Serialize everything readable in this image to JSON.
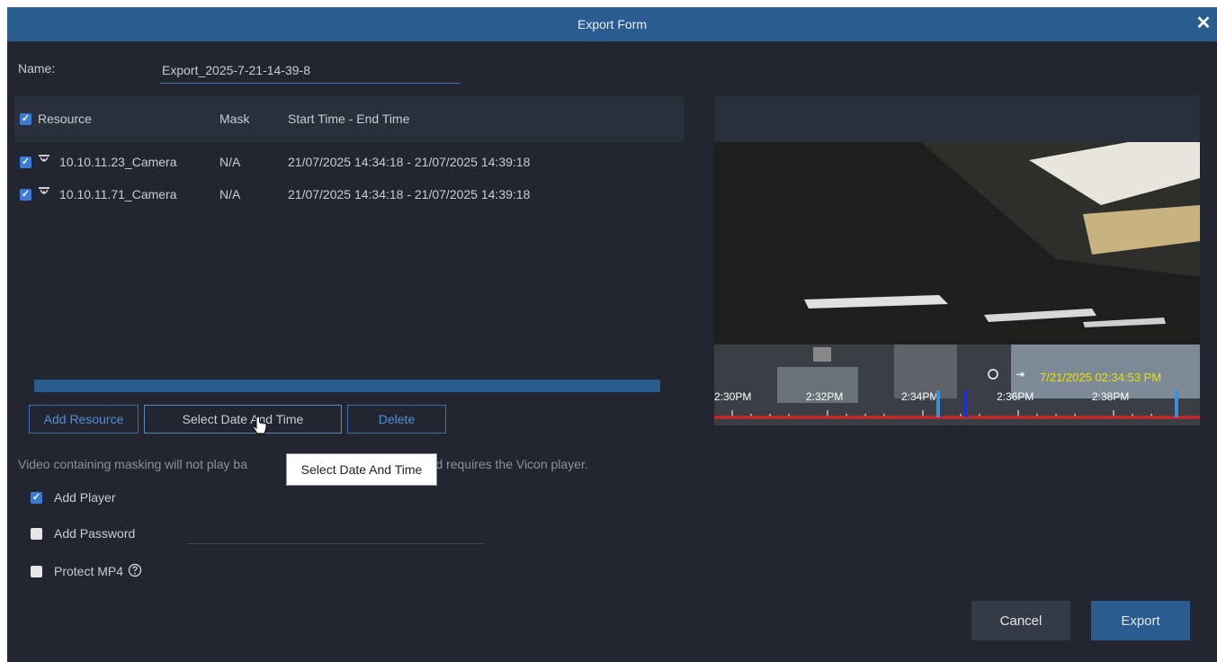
{
  "window": {
    "title": "Export Form"
  },
  "form": {
    "name_label": "Name:",
    "name_value": "Export_2025-7-21-14-39-8"
  },
  "table": {
    "columns": [
      "Resource",
      "Mask",
      "Start Time - End Time"
    ],
    "rows": [
      {
        "resource": "10.10.11.23_Camera",
        "mask": "N/A",
        "time": "21/07/2025 14:34:18 - 21/07/2025 14:39:18"
      },
      {
        "resource": "10.10.11.71_Camera",
        "mask": "N/A",
        "time": "21/07/2025 14:34:18 - 21/07/2025 14:39:18"
      }
    ]
  },
  "progress": {
    "value": 1.0
  },
  "buttons": {
    "add_resource": "Add Resource",
    "select_date_time": "Select Date And Time",
    "delete": "Delete",
    "cancel": "Cancel",
    "export": "Export"
  },
  "note": {
    "before": "Video containing masking will not play ba",
    "after": "and requires the Vicon player."
  },
  "options": {
    "add_player": {
      "label": "Add Player",
      "checked": true
    },
    "add_password": {
      "label": "Add Password",
      "checked": false
    },
    "protect_mp4": {
      "label": "Protect MP4",
      "checked": false
    }
  },
  "tooltip": {
    "text": "Select Date And Time"
  },
  "preview": {
    "timestamp": "7/21/2025 02:34:53 PM",
    "timeline_labels": [
      "2:30PM",
      "2:32PM",
      "2:34PM",
      "2:36PM",
      "2:38PM"
    ]
  },
  "colors": {
    "accent": "#2b5c8f",
    "timeline_red": "#e02020",
    "timestamp_yellow": "#e8e000"
  }
}
